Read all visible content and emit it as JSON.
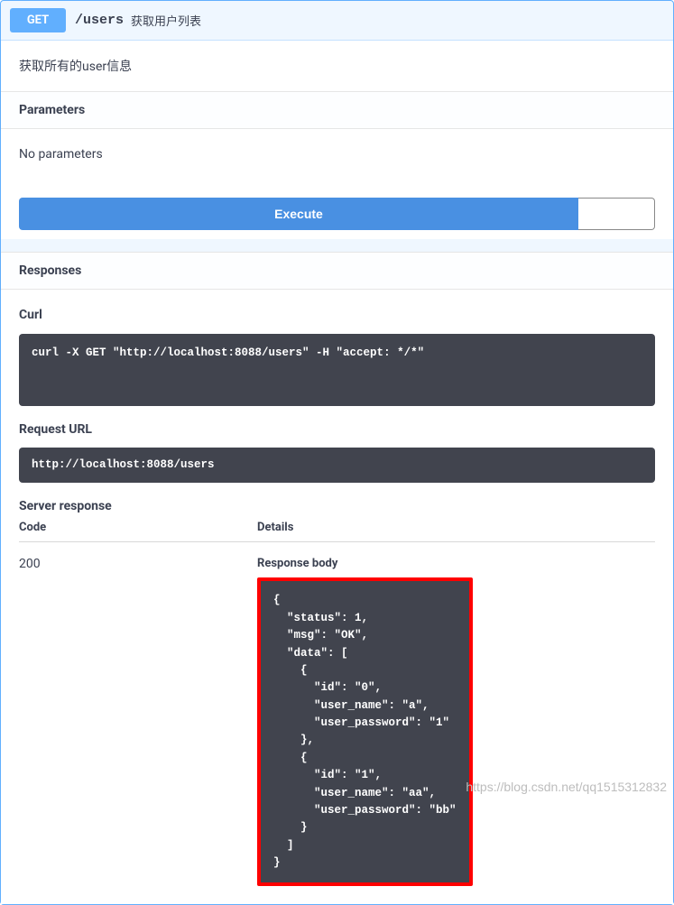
{
  "endpoint": {
    "method": "GET",
    "path": "/users",
    "summary": "获取用户列表",
    "description": "获取所有的user信息"
  },
  "sections": {
    "parameters": "Parameters",
    "no_parameters": "No parameters",
    "execute": "Execute",
    "responses": "Responses",
    "curl": "Curl",
    "request_url": "Request URL",
    "server_response": "Server response",
    "code": "Code",
    "details": "Details",
    "response_body": "Response body"
  },
  "curl_command": "curl -X GET \"http://localhost:8088/users\" -H \"accept: */*\"",
  "request_url": "http://localhost:8088/users",
  "response": {
    "status_code": "200",
    "body_raw": "{\n  \"status\": 1,\n  \"msg\": \"OK\",\n  \"data\": [\n    {\n      \"id\": \"0\",\n      \"user_name\": \"a\",\n      \"user_password\": \"1\"\n    },\n    {\n      \"id\": \"1\",\n      \"user_name\": \"aa\",\n      \"user_password\": \"bb\"\n    }\n  ]\n}",
    "body_json": {
      "status": 1,
      "msg": "OK",
      "data": [
        {
          "id": "0",
          "user_name": "a",
          "user_password": "1"
        },
        {
          "id": "1",
          "user_name": "aa",
          "user_password": "bb"
        }
      ]
    }
  },
  "watermark": "https://blog.csdn.net/qq1515312832"
}
